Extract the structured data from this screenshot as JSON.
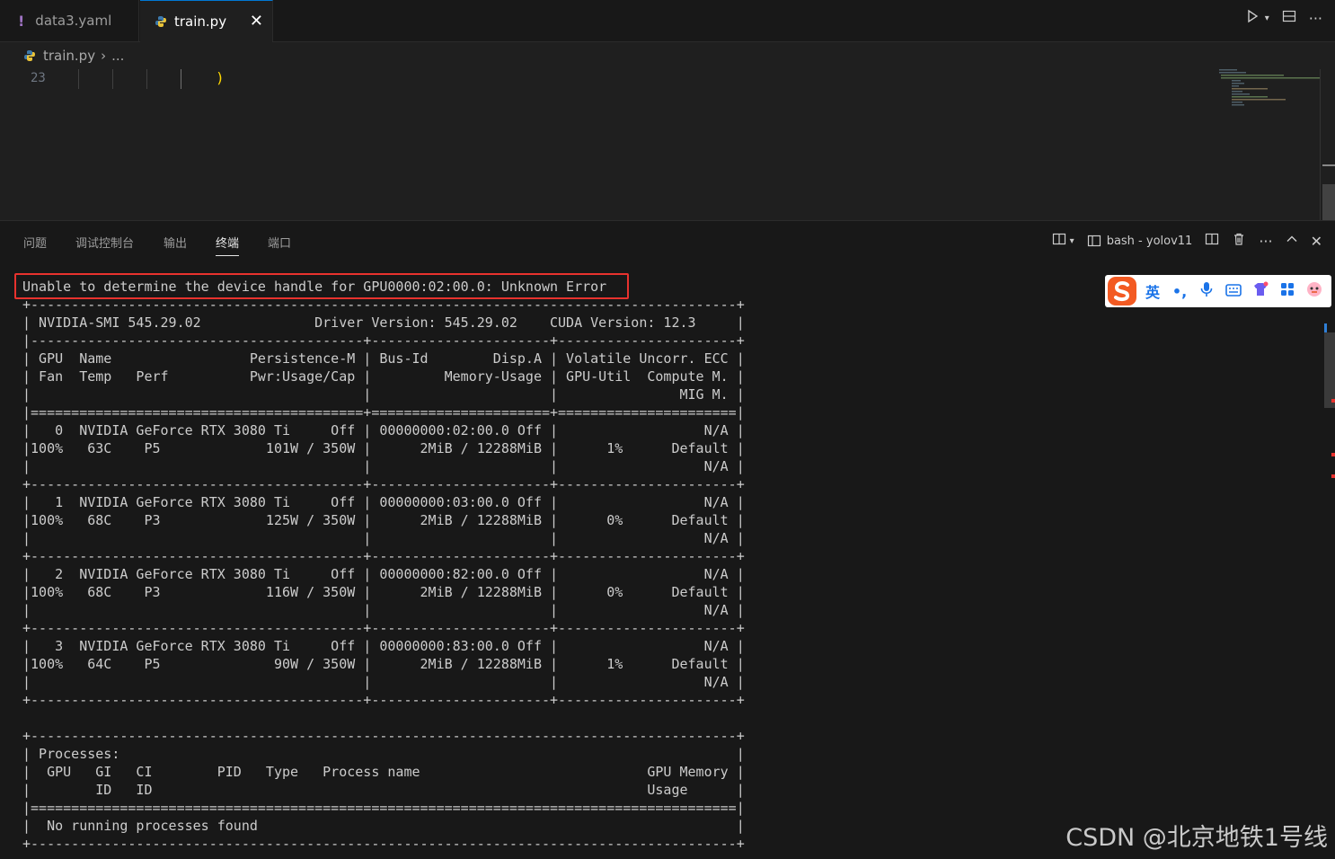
{
  "tabs": [
    {
      "label": "data3.yaml",
      "icon": "yaml-exclamation-icon"
    },
    {
      "label": "train.py",
      "icon": "python-icon",
      "active": true
    }
  ],
  "breadcrumb": {
    "file": "train.py",
    "separator": "›",
    "rest": "..."
  },
  "editor": {
    "line_number": "23",
    "code": ")"
  },
  "panel": {
    "tabs": [
      "问题",
      "调试控制台",
      "输出",
      "终端",
      "端口"
    ],
    "active_tab": "终端",
    "terminal_name": "bash - yolov11"
  },
  "terminal": {
    "error_line": "Unable to determine the device handle for GPU0000:02:00.0: Unknown Error",
    "output": "+---------------------------------------------------------------------------------------+\n| NVIDIA-SMI 545.29.02              Driver Version: 545.29.02    CUDA Version: 12.3     |\n|-----------------------------------------+----------------------+----------------------+\n| GPU  Name                 Persistence-M | Bus-Id        Disp.A | Volatile Uncorr. ECC |\n| Fan  Temp   Perf          Pwr:Usage/Cap |         Memory-Usage | GPU-Util  Compute M. |\n|                                         |                      |               MIG M. |\n|=========================================+======================+======================|\n|   0  NVIDIA GeForce RTX 3080 Ti     Off | 00000000:02:00.0 Off |                  N/A |\n|100%   63C    P5             101W / 350W |      2MiB / 12288MiB |      1%      Default |\n|                                         |                      |                  N/A |\n+-----------------------------------------+----------------------+----------------------+\n|   1  NVIDIA GeForce RTX 3080 Ti     Off | 00000000:03:00.0 Off |                  N/A |\n|100%   68C    P3             125W / 350W |      2MiB / 12288MiB |      0%      Default |\n|                                         |                      |                  N/A |\n+-----------------------------------------+----------------------+----------------------+\n|   2  NVIDIA GeForce RTX 3080 Ti     Off | 00000000:82:00.0 Off |                  N/A |\n|100%   68C    P3             116W / 350W |      2MiB / 12288MiB |      0%      Default |\n|                                         |                      |                  N/A |\n+-----------------------------------------+----------------------+----------------------+\n|   3  NVIDIA GeForce RTX 3080 Ti     Off | 00000000:83:00.0 Off |                  N/A |\n|100%   64C    P5              90W / 350W |      2MiB / 12288MiB |      1%      Default |\n|                                         |                      |                  N/A |\n+-----------------------------------------+----------------------+----------------------+\n\n+---------------------------------------------------------------------------------------+\n| Processes:                                                                            |\n|  GPU   GI   CI        PID   Type   Process name                            GPU Memory |\n|        ID   ID                                                             Usage      |\n|=======================================================================================|\n|  No running processes found                                                           |\n+---------------------------------------------------------------------------------------+"
  },
  "ime_toolbar": {
    "lang": "英",
    "punct": "•,"
  },
  "watermark": "CSDN @北京地铁1号线",
  "colors": {
    "error_box": "#e8322e",
    "accent": "#0078d4",
    "paren": "#ffd700"
  }
}
